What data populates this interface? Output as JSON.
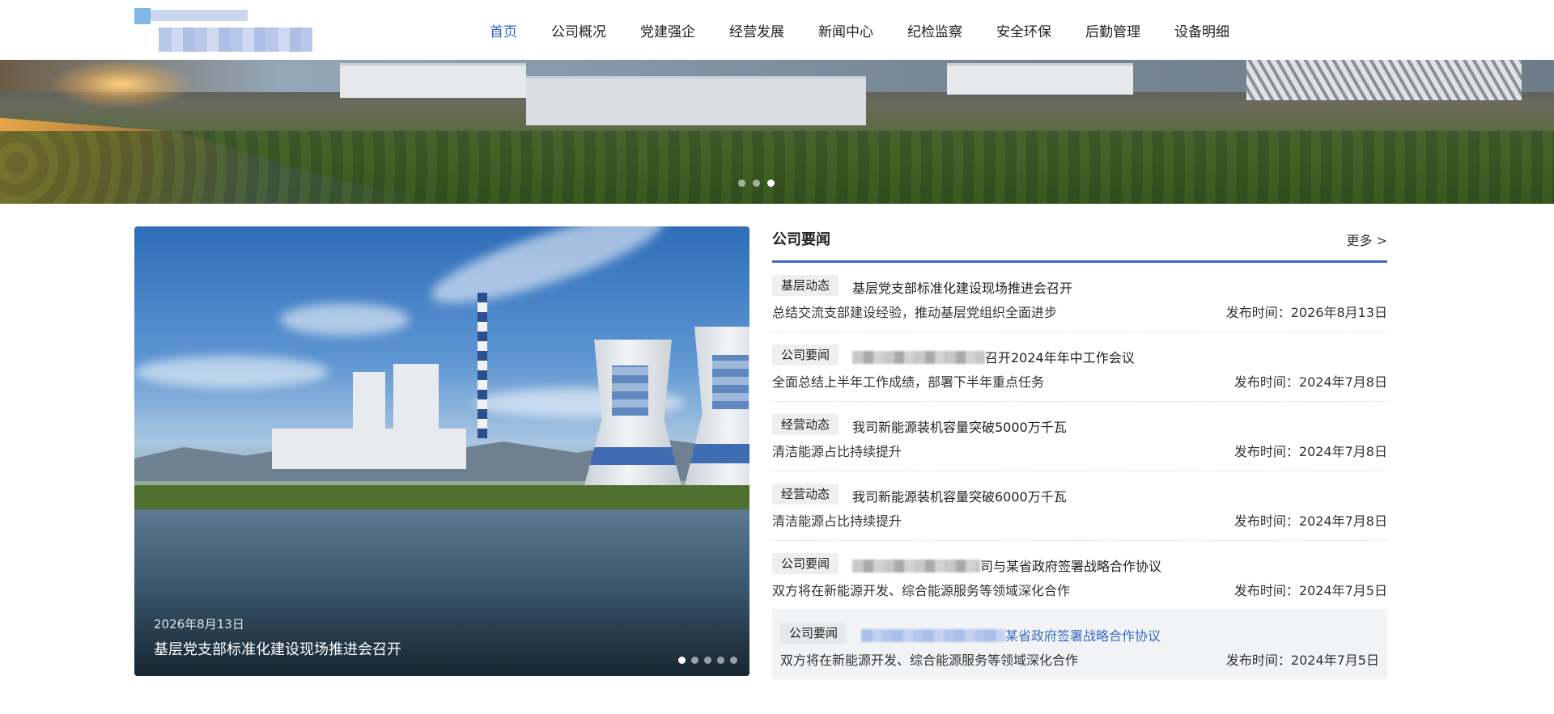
{
  "nav": {
    "items": [
      {
        "label": "首页",
        "active": true
      },
      {
        "label": "公司概况"
      },
      {
        "label": "党建强企"
      },
      {
        "label": "经营发展"
      },
      {
        "label": "新闻中心"
      },
      {
        "label": "纪检监察"
      },
      {
        "label": "安全环保"
      },
      {
        "label": "后勤管理"
      },
      {
        "label": "设备明细"
      }
    ]
  },
  "banner": {
    "slide_count": 3,
    "active_slide": 3
  },
  "carousel": {
    "date": "2026年8月13日",
    "title": "基层党支部标准化建设现场推进会召开",
    "slide_count": 5,
    "active_slide": 1
  },
  "news": {
    "title": "公司要闻",
    "more_label": "更多 >",
    "items": [
      {
        "tag": "基层动态",
        "title": "基层党支部标准化建设现场推进会召开",
        "summary": "总结交流支部建设经验，推动基层党组织全面进步",
        "date": "发布时间：2026年8月13日"
      },
      {
        "tag": "公司要闻",
        "title": "召开2024年年中工作会议",
        "summary": "全面总结上半年工作成绩，部署下半年重点任务",
        "date": "发布时间：2024年7月8日"
      },
      {
        "tag": "经营动态",
        "title": "我司新能源装机容量突破5000万千瓦",
        "summary": "清洁能源占比持续提升",
        "date": "发布时间：2024年7月8日"
      },
      {
        "tag": "经营动态",
        "title": "我司新能源装机容量突破6000万千瓦",
        "summary": "清洁能源占比持续提升",
        "date": "发布时间：2024年7月8日"
      },
      {
        "tag": "公司要闻",
        "title": "司与某省政府签署战略合作协议",
        "summary": "双方将在新能源开发、综合能源服务等领域深化合作",
        "date": "发布时间：2024年7月5日"
      },
      {
        "tag": "公司要闻",
        "title": "某省政府签署战略合作协议",
        "summary": "双方将在新能源开发、综合能源服务等领域深化合作",
        "date": "发布时间：2024年7月5日"
      }
    ]
  },
  "colors": {
    "accent": "#3b6cc4",
    "nav_active": "#2c62c9",
    "tag_bg": "#efefef"
  }
}
